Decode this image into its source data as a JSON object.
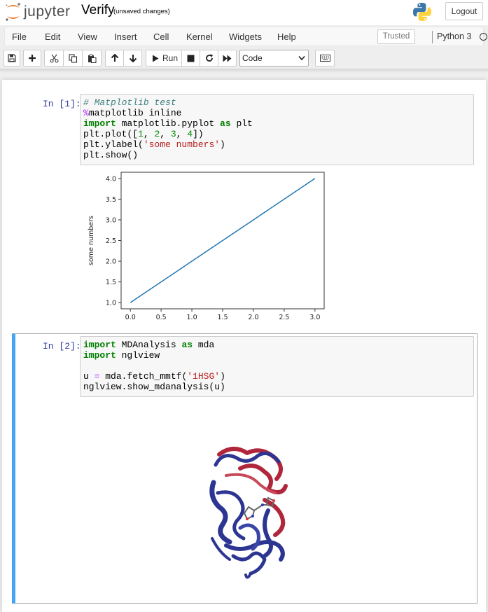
{
  "header": {
    "logo_text": "jupyter",
    "notebook_name": "Verify",
    "autosave_status": "(unsaved changes)",
    "logout_label": "Logout"
  },
  "menubar": {
    "items": [
      "File",
      "Edit",
      "View",
      "Insert",
      "Cell",
      "Kernel",
      "Widgets",
      "Help"
    ],
    "trusted_label": "Trusted",
    "kernel_name": "Python 3"
  },
  "toolbar": {
    "run_label": "Run",
    "cell_type": "Code",
    "icons": [
      "save-icon",
      "plus-icon",
      "cut-icon",
      "copy-icon",
      "paste-icon",
      "arrow-up-icon",
      "arrow-down-icon",
      "play-icon",
      "stop-icon",
      "restart-icon",
      "fast-forward-icon",
      "keyboard-icon"
    ]
  },
  "cells": [
    {
      "prompt": "In [1]:",
      "lines": [
        [
          {
            "t": "# Matplotlib test",
            "c": "comment"
          }
        ],
        [
          {
            "t": "%",
            "c": "magic"
          },
          {
            "t": "matplotlib inline",
            "c": "var"
          }
        ],
        [
          {
            "t": "import",
            "c": "kw"
          },
          {
            "t": " matplotlib.pyplot ",
            "c": "var"
          },
          {
            "t": "as",
            "c": "kw"
          },
          {
            "t": " plt",
            "c": "var"
          }
        ],
        [
          {
            "t": "plt.plot([",
            "c": "var"
          },
          {
            "t": "1",
            "c": "num"
          },
          {
            "t": ", ",
            "c": "var"
          },
          {
            "t": "2",
            "c": "num"
          },
          {
            "t": ", ",
            "c": "var"
          },
          {
            "t": "3",
            "c": "num"
          },
          {
            "t": ", ",
            "c": "var"
          },
          {
            "t": "4",
            "c": "num"
          },
          {
            "t": "])",
            "c": "var"
          }
        ],
        [
          {
            "t": "plt.ylabel(",
            "c": "var"
          },
          {
            "t": "'some numbers'",
            "c": "str"
          },
          {
            "t": ")",
            "c": "var"
          }
        ],
        [
          {
            "t": "plt.show()",
            "c": "var"
          }
        ]
      ]
    },
    {
      "prompt": "In [2]:",
      "lines": [
        [
          {
            "t": "import",
            "c": "kw"
          },
          {
            "t": " MDAnalysis ",
            "c": "var"
          },
          {
            "t": "as",
            "c": "kw"
          },
          {
            "t": " mda",
            "c": "var"
          }
        ],
        [
          {
            "t": "import",
            "c": "kw"
          },
          {
            "t": " nglview",
            "c": "var"
          }
        ],
        [
          {
            "t": "",
            "c": "var"
          }
        ],
        [
          {
            "t": "u ",
            "c": "var"
          },
          {
            "t": "=",
            "c": "op"
          },
          {
            "t": " mda.fetch_mmtf(",
            "c": "var"
          },
          {
            "t": "'1HSG'",
            "c": "str"
          },
          {
            "t": ")",
            "c": "var"
          }
        ],
        [
          {
            "t": "nglview.show_mdanalysis(u)",
            "c": "var"
          }
        ]
      ]
    }
  ],
  "chart_data": {
    "type": "line",
    "x": [
      0,
      1,
      2,
      3
    ],
    "series": [
      {
        "values": [
          1,
          2,
          3,
          4
        ],
        "color": "#1f77b4"
      }
    ],
    "xticks": [
      "0.0",
      "0.5",
      "1.0",
      "1.5",
      "2.0",
      "2.5",
      "3.0"
    ],
    "yticks": [
      "1.0",
      "1.5",
      "2.0",
      "2.5",
      "3.0",
      "3.5",
      "4.0"
    ],
    "xlim": [
      -0.15,
      3.15
    ],
    "ylim": [
      0.85,
      4.15
    ],
    "xlabel": "",
    "ylabel": "some numbers",
    "title": "",
    "grid": false
  },
  "colors": {
    "selected_cell_border": "#42a5f5",
    "prompt": "#303f9f",
    "protein_blue": "#2c3592",
    "protein_red": "#b0263a"
  }
}
